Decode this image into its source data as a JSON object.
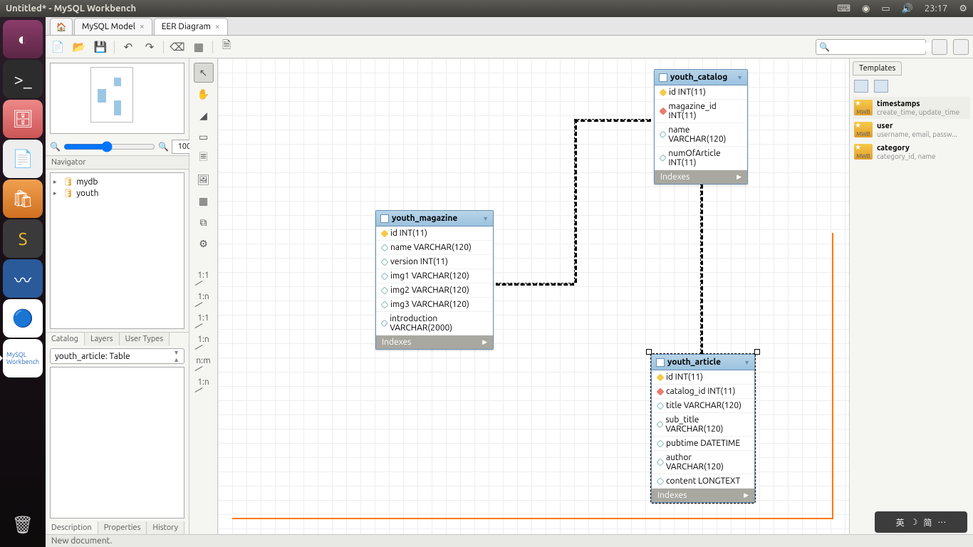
{
  "menubar": {
    "title": "Untitled* - MySQL Workbench",
    "clock": "23:17"
  },
  "tabs": {
    "model": "MySQL Model",
    "eer": "EER Diagram"
  },
  "zoom": {
    "value": "100"
  },
  "navigator": {
    "title": "Navigator"
  },
  "tree": {
    "db1": "mydb",
    "db2": "youth"
  },
  "nav_tabs": {
    "catalog": "Catalog",
    "layers": "Layers",
    "user_types": "User Types"
  },
  "obj_select": "youth_article: Table",
  "desc_tabs": {
    "description": "Description",
    "properties": "Properties",
    "history": "History"
  },
  "palette_labels": {
    "r11": "1:1",
    "r1n": "1:n",
    "r11b": "1:1",
    "r1nb": "1:n",
    "rnm": "n:m",
    "r1nc": "1:n"
  },
  "entities": {
    "catalog": {
      "name": "youth_catalog",
      "cols": [
        {
          "k": "pk",
          "t": "id INT(11)"
        },
        {
          "k": "fk",
          "t": "magazine_id INT(11)"
        },
        {
          "k": "col",
          "t": "name VARCHAR(120)"
        },
        {
          "k": "col",
          "t": "numOfArticle INT(11)"
        }
      ],
      "idx": "Indexes"
    },
    "magazine": {
      "name": "youth_magazine",
      "cols": [
        {
          "k": "pk",
          "t": "id INT(11)"
        },
        {
          "k": "col",
          "t": "name VARCHAR(120)"
        },
        {
          "k": "col",
          "t": "version INT(11)"
        },
        {
          "k": "col",
          "t": "img1 VARCHAR(120)"
        },
        {
          "k": "col",
          "t": "img2 VARCHAR(120)"
        },
        {
          "k": "col",
          "t": "img3 VARCHAR(120)"
        },
        {
          "k": "col",
          "t": "introduction VARCHAR(2000)"
        }
      ],
      "idx": "Indexes"
    },
    "article": {
      "name": "youth_article",
      "cols": [
        {
          "k": "pk",
          "t": "id INT(11)"
        },
        {
          "k": "fk",
          "t": "catalog_id INT(11)"
        },
        {
          "k": "col",
          "t": "title VARCHAR(120)"
        },
        {
          "k": "col",
          "t": "sub_title VARCHAR(120)"
        },
        {
          "k": "col",
          "t": "pubtime DATETIME"
        },
        {
          "k": "col",
          "t": "author VARCHAR(120)"
        },
        {
          "k": "col",
          "t": "content LONGTEXT"
        }
      ],
      "idx": "Indexes"
    }
  },
  "rsidebar": {
    "tab": "Templates",
    "templates": [
      {
        "name": "timestamps",
        "desc": "create_time, update_time"
      },
      {
        "name": "user",
        "desc": "username, email, passw..."
      },
      {
        "name": "category",
        "desc": "category_id, name"
      }
    ]
  },
  "status": "New document.",
  "ime": {
    "lang": "英",
    "mode": "简"
  }
}
